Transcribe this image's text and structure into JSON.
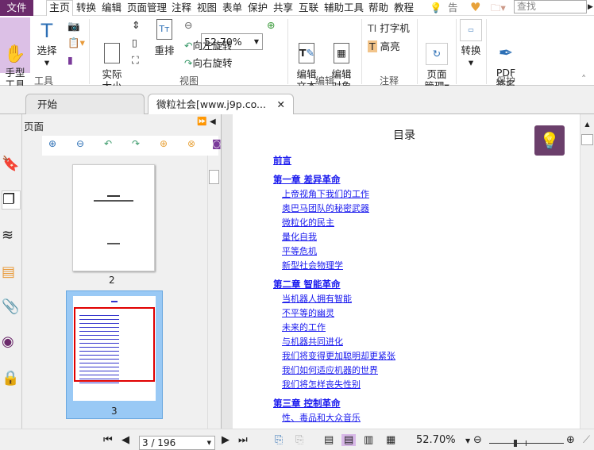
{
  "menubar": {
    "file": "文件",
    "tabs": [
      "主页",
      "转换",
      "编辑",
      "页面管理",
      "注释",
      "视图",
      "表单",
      "保护",
      "共享",
      "互联",
      "辅助工具",
      "帮助",
      "教程"
    ],
    "tell": "告诉",
    "search_placeholder": "查找"
  },
  "ribbon": {
    "tools": {
      "hand": "手型\n工具",
      "select": "选择",
      "group": "工具"
    },
    "view": {
      "actual": "实际\n大小",
      "reflow": "重排",
      "zoom": "52.70%",
      "rotate_left": "向左旋转",
      "rotate_right": "向右旋转",
      "group": "视图"
    },
    "edit": {
      "edit_text": "编辑\n文本",
      "edit_object": "编辑\n对象",
      "group": "编辑"
    },
    "comment": {
      "typewriter": "打字机",
      "highlight": "高亮",
      "group": "注释"
    },
    "page": {
      "manage": "页面\n管理"
    },
    "convert": {
      "convert": "转换"
    },
    "protect": {
      "sign": "PDF\n签名",
      "group": "保护"
    }
  },
  "tabs": [
    {
      "label": "开始"
    },
    {
      "label": "微粒社会[www.j9p.co..."
    }
  ],
  "panel": {
    "title": "页面",
    "thumbnails": [
      {
        "label": "2"
      },
      {
        "label": "3",
        "selected": true
      }
    ]
  },
  "document": {
    "title": "目录",
    "toc": [
      {
        "t": "前言",
        "ch": true
      },
      {
        "t": "第一章 差异革命",
        "ch": true
      },
      {
        "t": "上帝视角下我们的工作"
      },
      {
        "t": "奥巴马团队的秘密武器"
      },
      {
        "t": "微粒化的民主"
      },
      {
        "t": "量化自我"
      },
      {
        "t": "平等危机"
      },
      {
        "t": "新型社会物理学"
      },
      {
        "t": "第二章 智能革命",
        "ch": true
      },
      {
        "t": "当机器人拥有智能"
      },
      {
        "t": "不平等的幽灵"
      },
      {
        "t": "未来的工作"
      },
      {
        "t": "与机器共同进化"
      },
      {
        "t": "我们将变得更加聪明却更紧张"
      },
      {
        "t": "我们如何适应机器的世界"
      },
      {
        "t": "我们将怎样丧失性别"
      },
      {
        "t": "第三章 控制革命",
        "ch": true
      },
      {
        "t": "性、毒品和大众音乐"
      }
    ]
  },
  "status": {
    "page": "3 / 196",
    "zoom": "52.70%",
    "zoom_level": 0.35
  },
  "colors": {
    "accent": "#6b2a6b",
    "link": "#1a1aee",
    "selection": "#99c9f5",
    "highlight_box": "#e00000"
  }
}
